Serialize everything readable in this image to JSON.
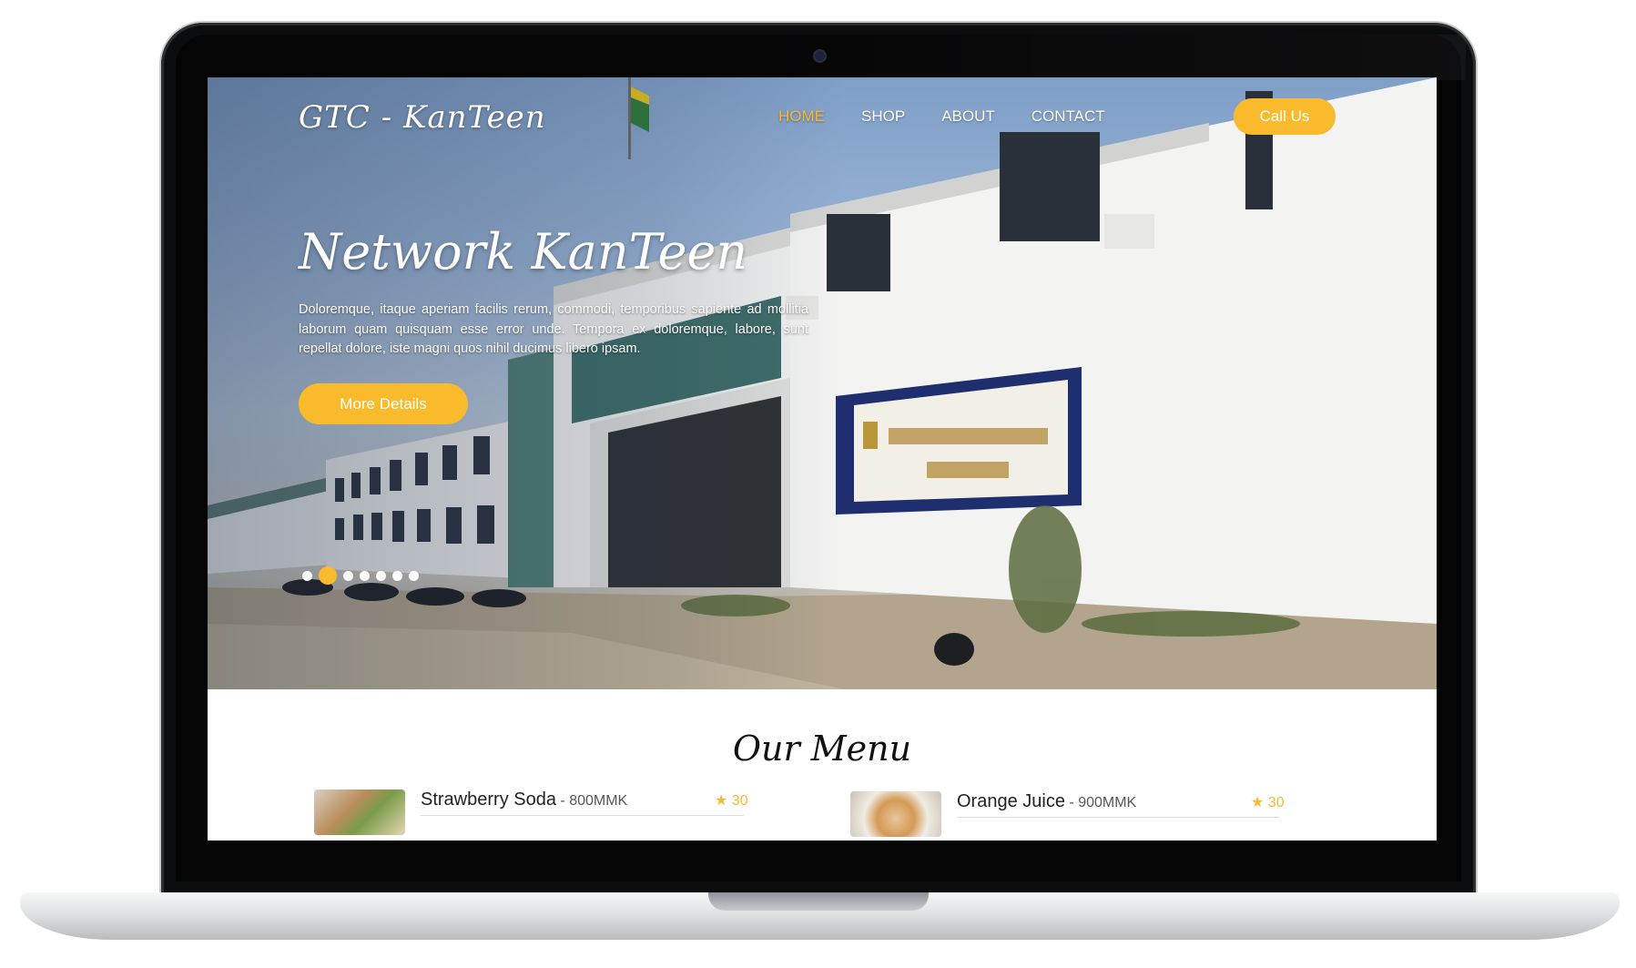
{
  "brand": "GTC - KanTeen",
  "nav": {
    "items": [
      "HOME",
      "SHOP",
      "ABOUT",
      "CONTACT"
    ],
    "active": "HOME",
    "call_label": "Call Us"
  },
  "hero": {
    "title": "Network KanTeen",
    "description": "Doloremque, itaque aperiam facilis rerum, commodi, temporibus sapiente ad mollitia laborum quam quisquam esse error unde. Tempora ex doloremque, labore, sunt repellat dolore, iste magni quos nihil ducimus libero ipsam.",
    "button_label": "More Details",
    "slides": 7,
    "active_slide": 2
  },
  "menu": {
    "title": "Our Menu",
    "items": [
      {
        "name": "Strawberry Soda",
        "price": " - 800MMK",
        "rating": "30"
      },
      {
        "name": "Orange Juice",
        "price": " - 900MMK",
        "rating": "30"
      }
    ]
  },
  "colors": {
    "accent": "#f9bb2c",
    "nav_active": "#f8b830"
  }
}
